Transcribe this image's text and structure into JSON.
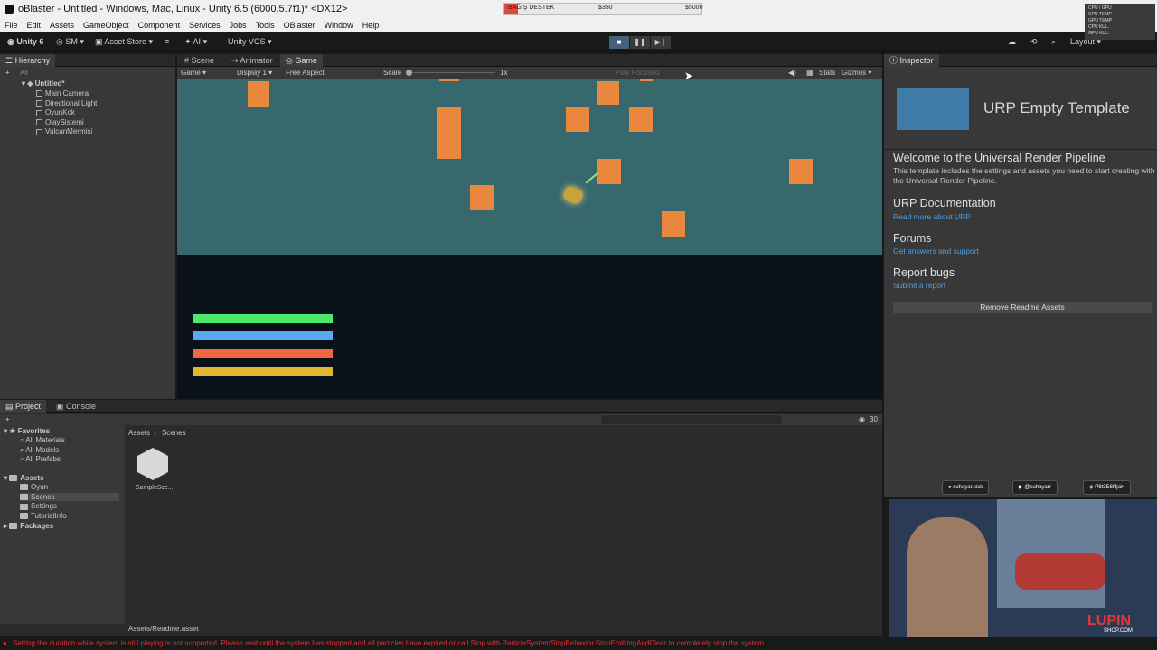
{
  "title_bar": {
    "window_title": "oBlaster - Untitled - Windows, Mac, Linux - Unity 6.5 (6000.5.7f1)* <DX12>",
    "donation_label": "BAĞIŞ DESTEK",
    "donation_current": "$350",
    "donation_goal": "$5000",
    "donation_progress": 0.07
  },
  "menu": [
    "File",
    "Edit",
    "Assets",
    "GameObject",
    "Component",
    "Services",
    "Jobs",
    "Tools",
    "OBlaster",
    "Window",
    "Help"
  ],
  "toolbar": {
    "account": "Unity 6",
    "user": "SM",
    "asset_store": "Asset Store",
    "ai": "AI",
    "vcs": "Unity VCS",
    "layout": "Layout"
  },
  "hierarchy": {
    "tab": "Hierarchy",
    "search_placeholder": "All",
    "scene": "Untitled*",
    "items": [
      "Main Camera",
      "Directional Light",
      "OyunKok",
      "OlaySistemi",
      "VulcanMermisi"
    ]
  },
  "view_tabs": {
    "scene": "Scene",
    "animator": "Animator",
    "game": "Game"
  },
  "game_bar": {
    "mode": "Game",
    "display": "Display 1",
    "aspect": "Free Aspect",
    "scale_label": "Scale",
    "scale_value": "1x",
    "play_focused": "Play Focused",
    "stats": "Stats",
    "gizmos": "Gizmos"
  },
  "colors": {
    "sky": "#36686d",
    "block": "#e9873c",
    "bar_green": "#4be96b",
    "bar_blue": "#59a8f2",
    "bar_orange": "#ec6a3c",
    "bar_yellow": "#e0b830"
  },
  "inspector": {
    "tab": "Inspector",
    "template_title": "URP Empty Template",
    "welcome_heading": "Welcome to the Universal Render Pipeline",
    "welcome_text": "This template includes the settings and assets you need to start creating with the Universal Render Pipeline.",
    "doc_heading": "URP Documentation",
    "doc_link": "Read more about URP",
    "forums_heading": "Forums",
    "forums_link": "Get answers and support",
    "bugs_heading": "Report bugs",
    "bugs_link": "Submit a report",
    "remove_button": "Remove Readme Assets"
  },
  "project": {
    "tab_project": "Project",
    "tab_console": "Console",
    "favorites": "Favorites",
    "fav_items": [
      "All Materials",
      "All Models",
      "All Prefabs"
    ],
    "assets": "Assets",
    "asset_folders": [
      "Oyun",
      "Scenes",
      "Settings",
      "TutorialInfo"
    ],
    "packages": "Packages",
    "breadcrumb_root": "Assets",
    "breadcrumb_current": "Scenes",
    "asset_name": "SampleSce...",
    "count": "30",
    "footer_path": "Assets/Readme.asset"
  },
  "status": {
    "message": "Setting the duration while system is still playing is not supported. Please wait until the system has stopped and all particles have expired or call Stop with ParticleSystemStopBehavior.StopEmittingAndClear to completely stop the system."
  },
  "stream": {
    "kick": "suhayar.kick",
    "youtube": "@suhayarr",
    "discord": "P8t3E6NjaH",
    "brand": "LUPIN",
    "brand_sub": "SHOP.COM"
  }
}
